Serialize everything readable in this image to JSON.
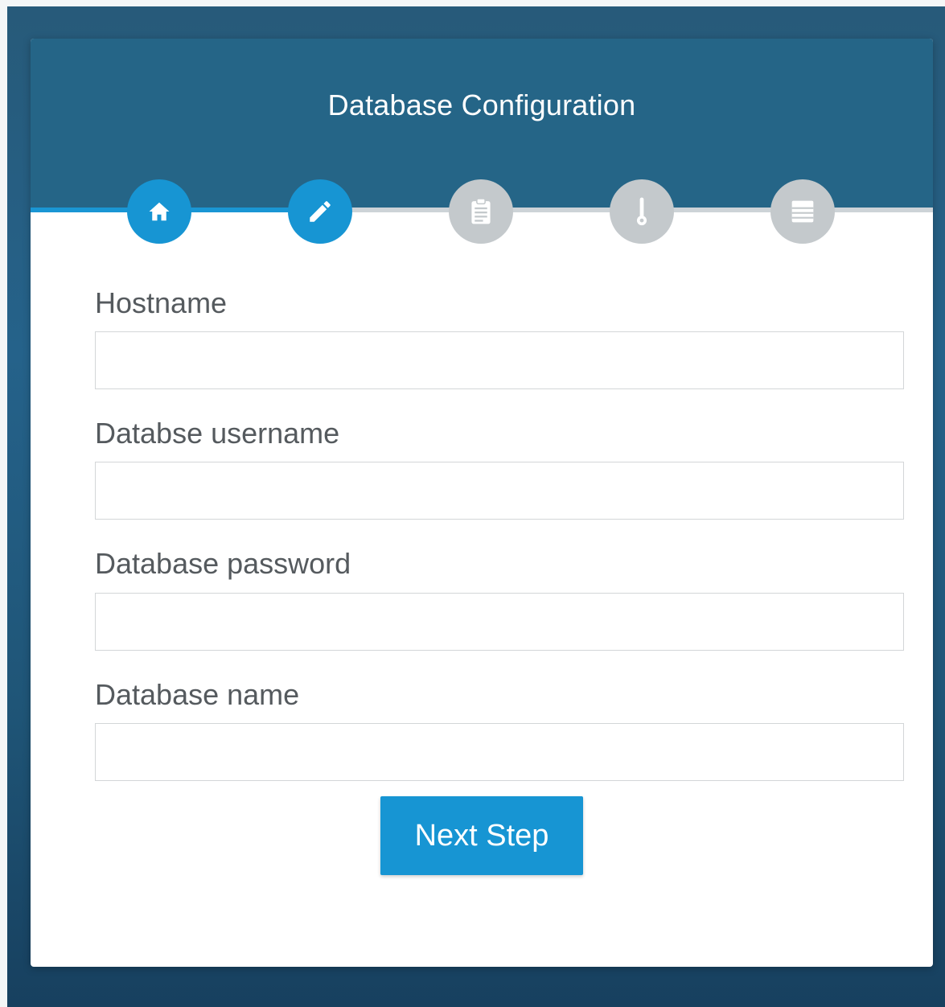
{
  "page": {
    "title": "Database Configuration"
  },
  "wizard": {
    "steps": [
      {
        "icon": "home-icon",
        "status": "complete"
      },
      {
        "icon": "pencil-icon",
        "status": "current"
      },
      {
        "icon": "clipboard-icon",
        "status": "pending"
      },
      {
        "icon": "thermometer-icon",
        "status": "pending"
      },
      {
        "icon": "list-icon",
        "status": "pending"
      }
    ]
  },
  "form": {
    "hostname": {
      "label": "Hostname",
      "value": "",
      "placeholder": ""
    },
    "username": {
      "label": "Databse username",
      "value": "",
      "placeholder": ""
    },
    "password": {
      "label": "Database password",
      "value": "",
      "placeholder": ""
    },
    "dbname": {
      "label": "Database name",
      "value": "",
      "placeholder": ""
    },
    "submit_label": "Next Step"
  },
  "colors": {
    "header": "#256587",
    "accent": "#1795d3",
    "pending": "#c4c9cc"
  }
}
